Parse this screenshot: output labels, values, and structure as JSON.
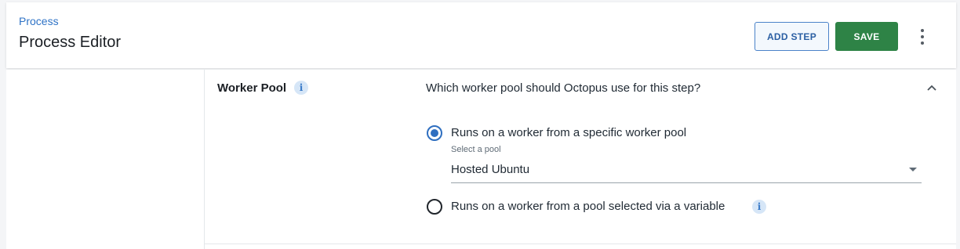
{
  "header": {
    "breadcrumb": "Process",
    "title": "Process Editor",
    "add_step_label": "ADD STEP",
    "save_label": "SAVE",
    "more_icon": "more-vertical-icon"
  },
  "worker_pool": {
    "title": "Worker Pool",
    "info_icon": "info-icon",
    "question": "Which worker pool should Octopus use for this step?",
    "collapse_icon": "chevron-up-icon",
    "options": [
      {
        "label": "Runs on a worker from a specific worker pool",
        "selected": true
      },
      {
        "label": "Runs on a worker from a pool selected via a variable",
        "selected": false
      }
    ],
    "pool_select": {
      "label": "Select a pool",
      "value": "Hosted Ubuntu"
    }
  },
  "colors": {
    "accent": "#2f6fc0",
    "save_button": "#2e8346",
    "link": "#2f73c6"
  }
}
